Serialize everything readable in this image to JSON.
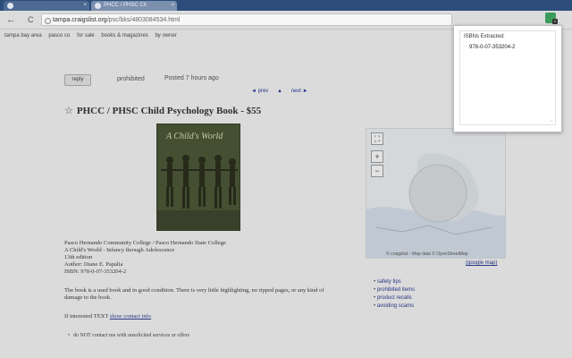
{
  "browser": {
    "tabs": [
      {
        "label": "",
        "active": false
      },
      {
        "label": "PHCC / PHSC Ch",
        "active": true
      }
    ],
    "back_glyph": "←",
    "reload_glyph": "C",
    "address": {
      "domain": "tampa.craigslist.org",
      "path": "/psc/bks/4803084534.html"
    }
  },
  "page": {
    "breadcrumbs": [
      "tampa bay area",
      "pasco co",
      "for sale",
      "books & magazines",
      "by owner"
    ],
    "reply_label": "reply",
    "prohibited_label": "prohibited",
    "posted_label": "Posted 7 hours ago",
    "pager": {
      "prev": "◄ prev",
      "up": "▲",
      "next": "next ►"
    },
    "title": "PHCC / PHSC Child Psychology Book - $55",
    "book_cover_title": "A Child's World",
    "details": [
      "Pasco Hernando Community College / Pasco Hernando State College",
      "A Child's World - Infancy through Adolescence",
      "13th edition",
      "Author: Diane E. Papalia",
      "ISBN: 978-0-07-353204-2"
    ],
    "description": "The book is a used book and in good condition. There is very little highlighting, no ripped pages, or any kind of damage to the book.",
    "contact": {
      "prefix": "If interested TEXT",
      "link": "show contact info"
    },
    "notice": "do NOT contact me with unsolicited services or offers",
    "map": {
      "zoom_in": "+",
      "zoom_out": "−",
      "fullscreen": "⛶",
      "attribution": "© craigslist - Map data © OpenStreetMap",
      "google_map": "(google map)"
    },
    "side_links": [
      "safety tips",
      "prohibited items",
      "product recalls",
      "avoiding scams"
    ]
  },
  "extension": {
    "header": "ISBNs Extracted:",
    "isbns": [
      "978-0-07-353204-2"
    ],
    "badge": "1",
    "grip_glyph": "⌟"
  },
  "icons": {
    "star": "☆"
  }
}
